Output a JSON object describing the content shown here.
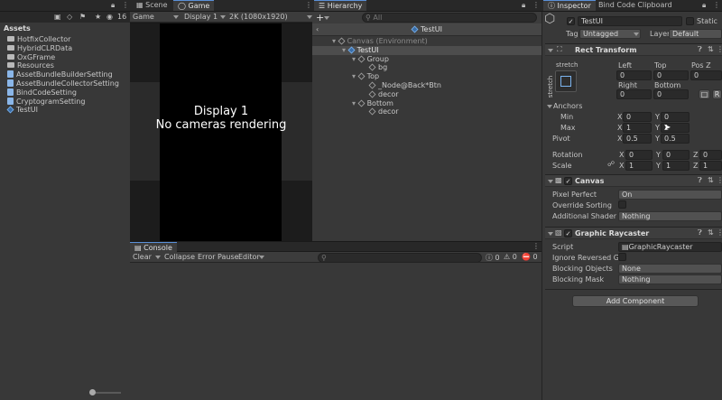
{
  "project": {
    "lock_icon": "lock-icon",
    "menu_icon": "kebab-icon",
    "header": "Assets",
    "badge_count": "16",
    "items": [
      {
        "label": "HotfixCollector",
        "kind": "folder"
      },
      {
        "label": "HybridCLRData",
        "kind": "folder"
      },
      {
        "label": "OxGFrame",
        "kind": "folder"
      },
      {
        "label": "Resources",
        "kind": "folder"
      },
      {
        "label": "AssetBundleBuilderSetting",
        "kind": "asset"
      },
      {
        "label": "AssetBundleCollectorSetting",
        "kind": "asset"
      },
      {
        "label": "BindCodeSetting",
        "kind": "asset"
      },
      {
        "label": "CryptogramSetting",
        "kind": "asset"
      },
      {
        "label": "TestUI",
        "kind": "prefab"
      }
    ]
  },
  "tabs": {
    "scene": "Scene",
    "game": "Game",
    "hierarchy": "Hierarchy",
    "inspector": "Inspector",
    "bind_code": "Bind Code Clipboard",
    "console": "Console"
  },
  "game": {
    "mode": "Game",
    "display": "Display 1",
    "resolution": "2K (1080x1920)",
    "overlay_line1": "Display 1",
    "overlay_line2": "No cameras rendering"
  },
  "hierarchy": {
    "search_placeholder": "All",
    "add_label": "+",
    "prefab_title": "TestUI",
    "nodes": [
      {
        "label": "Canvas (Environment)",
        "depth": 0,
        "style": "dim"
      },
      {
        "label": "TestUI",
        "depth": 1,
        "style": "selected"
      },
      {
        "label": "Group",
        "depth": 2,
        "style": "normal"
      },
      {
        "label": "bg",
        "depth": 3,
        "style": "normal"
      },
      {
        "label": "Top",
        "depth": 2,
        "style": "normal"
      },
      {
        "label": "_Node@Back*Btn",
        "depth": 3,
        "style": "normal"
      },
      {
        "label": "decor",
        "depth": 3,
        "style": "normal"
      },
      {
        "label": "Bottom",
        "depth": 2,
        "style": "normal"
      },
      {
        "label": "decor",
        "depth": 3,
        "style": "normal"
      }
    ]
  },
  "console": {
    "clear": "Clear",
    "collapse": "Collapse",
    "error_pause": "Error Pause",
    "editor": "Editor",
    "count_log": "0",
    "count_warn": "0",
    "count_err": "0"
  },
  "inspector": {
    "object_name": "TestUI",
    "static_label": "Static",
    "tag_label": "Tag",
    "tag_value": "Untagged",
    "layer_label": "Layer",
    "layer_value": "Default",
    "rect_transform": {
      "title": "Rect Transform",
      "anchor_preset_h": "stretch",
      "anchor_preset_v": "stretch",
      "left_label": "Left",
      "left": "0",
      "top_label": "Top",
      "top": "0",
      "posz_label": "Pos Z",
      "posz": "0",
      "right_label": "Right",
      "right": "0",
      "bottom_label": "Bottom",
      "bottom": "0",
      "anchors_label": "Anchors",
      "min_label": "Min",
      "min_x": "0",
      "min_y": "0",
      "max_label": "Max",
      "max_x": "1",
      "max_y": "1",
      "pivot_label": "Pivot",
      "pivot_x": "0.5",
      "pivot_y": "0.5",
      "rotation_label": "Rotation",
      "rot_x": "0",
      "rot_y": "0",
      "rot_z": "0",
      "scale_label": "Scale",
      "scale_x": "1",
      "scale_y": "1",
      "scale_z": "1",
      "x": "X",
      "y": "Y",
      "z": "Z",
      "r": "R"
    },
    "canvas": {
      "title": "Canvas",
      "pixel_perfect_label": "Pixel Perfect",
      "pixel_perfect_value": "On",
      "override_sorting_label": "Override Sorting",
      "shader_label": "Additional Shader Ch",
      "shader_value": "Nothing"
    },
    "raycaster": {
      "title": "Graphic Raycaster",
      "script_label": "Script",
      "script_value": "GraphicRaycaster",
      "ignore_label": "Ignore Reversed Gra",
      "blocking_objects_label": "Blocking Objects",
      "blocking_objects_value": "None",
      "blocking_mask_label": "Blocking Mask",
      "blocking_mask_value": "Nothing"
    },
    "add_component": "Add Component"
  }
}
